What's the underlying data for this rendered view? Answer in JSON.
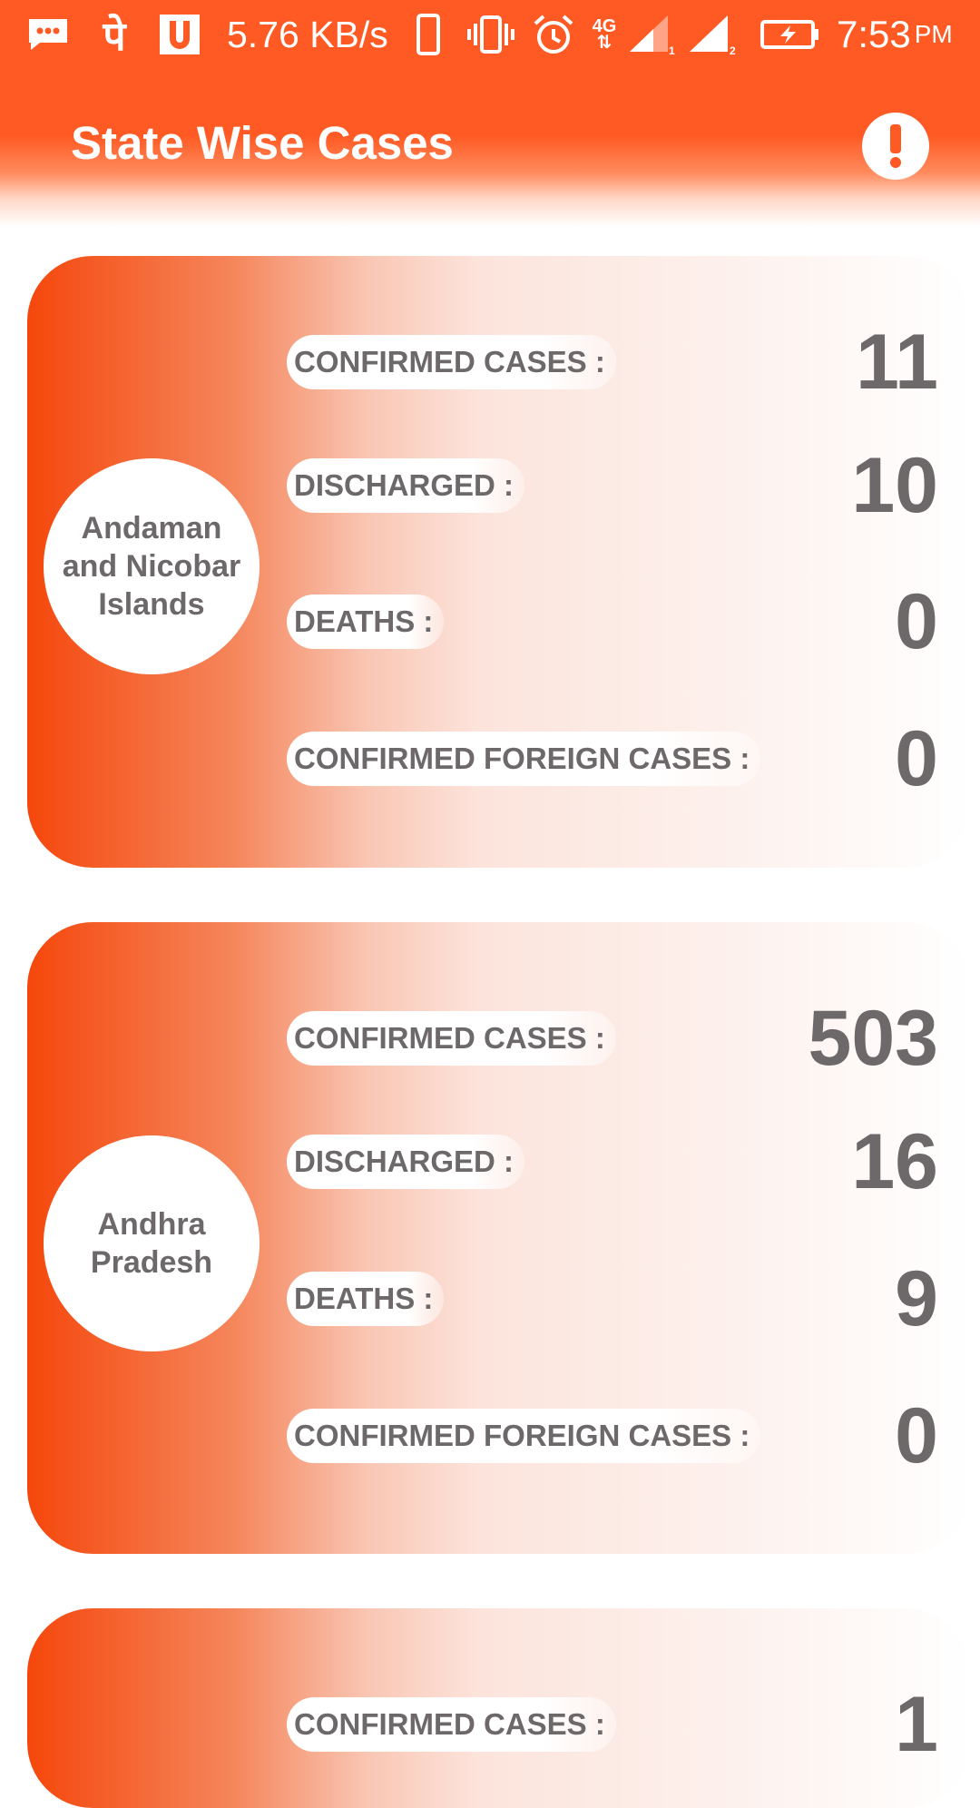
{
  "status_bar": {
    "app_glyph": "पे",
    "network_speed": "5.76 KB/s",
    "network_type": "4G",
    "time": "7:53",
    "ampm": "PM",
    "icons": [
      "message-icon",
      "pe-app-icon",
      "u-app-icon",
      "phone-icon",
      "vibrate-icon",
      "alarm-icon",
      "4g-icon",
      "signal-sim1-icon",
      "signal-sim2-icon",
      "battery-charging-icon"
    ]
  },
  "app_bar": {
    "title": "State Wise Cases",
    "info_icon": "exclamation-icon"
  },
  "colors": {
    "primary": "#ff5a24",
    "card_gradient_start": "#f5470c",
    "text_gray": "#6d6869",
    "white": "#ffffff"
  },
  "states": [
    {
      "name": "Andaman and Nicobar Islands",
      "stats": [
        {
          "label": "CONFIRMED CASES :",
          "value": "11"
        },
        {
          "label": "DISCHARGED :",
          "value": "10"
        },
        {
          "label": "DEATHS :",
          "value": "0"
        },
        {
          "label": "CONFIRMED FOREIGN CASES :",
          "value": "0"
        }
      ]
    },
    {
      "name": "Andhra Pradesh",
      "stats": [
        {
          "label": "CONFIRMED CASES :",
          "value": "503"
        },
        {
          "label": "DISCHARGED :",
          "value": "16"
        },
        {
          "label": "DEATHS :",
          "value": "9"
        },
        {
          "label": "CONFIRMED FOREIGN CASES :",
          "value": "0"
        }
      ]
    },
    {
      "name": "",
      "stats": [
        {
          "label": "CONFIRMED CASES :",
          "value": "1"
        }
      ]
    }
  ]
}
